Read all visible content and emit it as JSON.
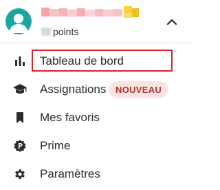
{
  "user": {
    "points_label": "points"
  },
  "menu": {
    "items": [
      {
        "label": "Tableau de bord",
        "icon": "bar-chart-icon"
      },
      {
        "label": "Assignations",
        "icon": "graduation-cap-icon",
        "badge": "NOUVEAU"
      },
      {
        "label": "Mes favoris",
        "icon": "bookmark-icon"
      },
      {
        "label": "Prime",
        "icon": "prime-badge-icon"
      },
      {
        "label": "Paramètres",
        "icon": "gear-icon"
      }
    ]
  },
  "colors": {
    "avatar": "#1aa7a2",
    "highlight_border": "#d82129",
    "badge_bg": "#fbe3e1",
    "badge_text": "#b2332c",
    "icon": "#2b2b2b"
  }
}
